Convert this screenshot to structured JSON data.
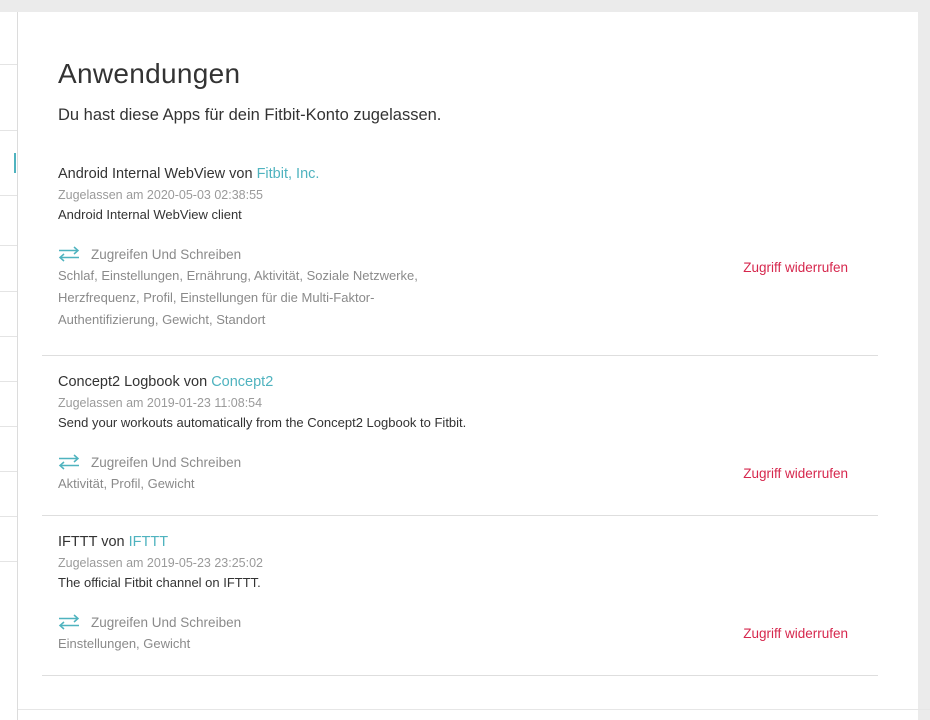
{
  "page": {
    "title": "Anwendungen",
    "subtitle": "Du hast diese Apps für dein Fitbit-Konto zugelassen."
  },
  "colors": {
    "link": "#4fb3bf",
    "revoke": "#d6274d",
    "muted": "#9a9a9a"
  },
  "apps": [
    {
      "name": "Android Internal WebView",
      "by": " von ",
      "developer": "Fitbit, Inc.",
      "authorized": "Zugelassen am 2020-05-03 02:38:55",
      "description": "Android Internal WebView client",
      "access_icon": "arrows-exchange-icon",
      "access": "Zugreifen Und Schreiben",
      "scopes": "Schlaf, Einstellungen, Ernährung, Aktivität, Soziale Netzwerke, Herzfrequenz, Profil, Einstellungen für die Multi-Faktor-Authentifizierung, Gewicht, Standort",
      "revoke": "Zugriff widerrufen"
    },
    {
      "name": "Concept2 Logbook",
      "by": " von ",
      "developer": "Concept2",
      "authorized": "Zugelassen am 2019-01-23 11:08:54",
      "description": "Send your workouts automatically from the Concept2 Logbook to Fitbit.",
      "access_icon": "arrows-exchange-icon",
      "access": "Zugreifen Und Schreiben",
      "scopes": "Aktivität, Profil, Gewicht",
      "revoke": "Zugriff widerrufen"
    },
    {
      "name": "IFTTT",
      "by": " von ",
      "developer": "IFTTT",
      "authorized": "Zugelassen am 2019-05-23 23:25:02",
      "description": "The official Fitbit channel on IFTTT.",
      "access_icon": "arrows-exchange-icon",
      "access": "Zugreifen Und Schreiben",
      "scopes": "Einstellungen, Gewicht",
      "revoke": "Zugriff widerrufen"
    }
  ]
}
